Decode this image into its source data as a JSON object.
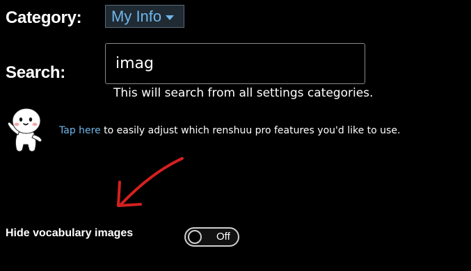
{
  "filters": {
    "category_label": "Category:",
    "category_value": "My Info",
    "search_label": "Search:",
    "search_value": "imag",
    "search_hint": "This will search from all settings categories."
  },
  "promo": {
    "link_text": "Tap here",
    "rest_text": " to easily adjust which renshuu pro features you'd like to use."
  },
  "settings": [
    {
      "label": "Hide vocabulary images",
      "toggle_state": "Off"
    }
  ],
  "colors": {
    "background": "#000000",
    "link": "#6fb6ea",
    "annotation_arrow": "#d42020"
  },
  "icons": {
    "mascot": "renshuu-mascot",
    "dropdown": "caret-down-icon",
    "annotation": "red-arrow"
  }
}
